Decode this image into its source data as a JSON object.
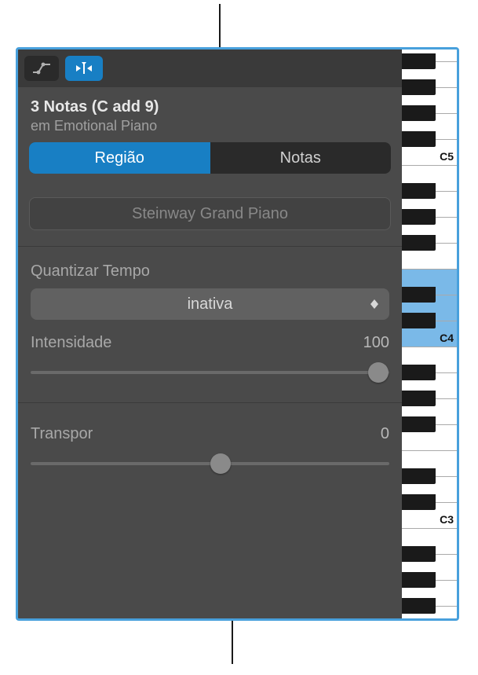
{
  "toolbar": {
    "automation_icon": "automation-icon",
    "catch_icon": "catch-icon"
  },
  "selection": {
    "title": "3 Notas (C add 9)",
    "subtitle_prefix": "em ",
    "subtitle_name": "Emotional Piano"
  },
  "tabs": {
    "region": "Região",
    "notes": "Notas"
  },
  "region_name": "Steinway Grand Piano",
  "quantize": {
    "label": "Quantizar Tempo",
    "value": "inativa"
  },
  "intensity": {
    "label": "Intensidade",
    "value": "100",
    "percent": 97
  },
  "transpose": {
    "label": "Transpor",
    "value": "0",
    "percent": 53
  },
  "piano": {
    "labels": {
      "c5": "C5",
      "c4": "C4",
      "c3": "C3"
    },
    "selected": [
      "E4",
      "D4",
      "C4"
    ]
  }
}
